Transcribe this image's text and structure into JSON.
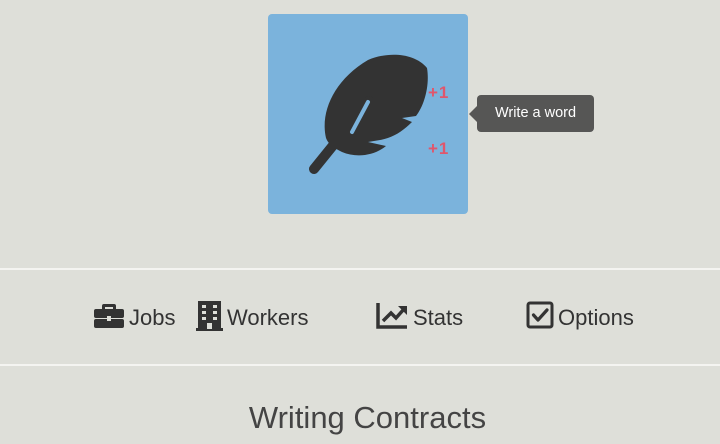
{
  "action": {
    "plus_a": "+1",
    "plus_b": "+1",
    "tooltip": "Write a word"
  },
  "nav": {
    "jobs": "Jobs",
    "workers": "Workers",
    "stats": "Stats",
    "options": "Options"
  },
  "section": {
    "title": "Writing Contracts"
  },
  "colors": {
    "background": "#dedfd9",
    "button": "#7bb3dc",
    "icon": "#333333",
    "plus": "#e0566c",
    "tooltip": "#565655"
  },
  "icons": {
    "action": "feather-icon",
    "jobs": "briefcase-icon",
    "workers": "building-icon",
    "stats": "chart-line-icon",
    "options": "checkbox-icon"
  }
}
